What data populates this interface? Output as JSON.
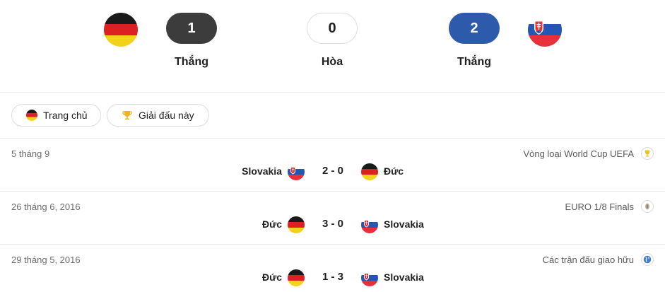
{
  "colors": {
    "dark_pill": "#3c3c3c",
    "blue_pill": "#2e5aac",
    "divider": "#ececec",
    "muted_text": "#6b6b6b"
  },
  "summary": {
    "left_team_flag": "germany-flag",
    "right_team_flag": "slovakia-flag",
    "wins_left": "1",
    "draws": "0",
    "wins_right": "2",
    "wins_left_label": "Thắng",
    "draws_label": "Hòa",
    "wins_right_label": "Thắng"
  },
  "filters": [
    {
      "label": "Trang chủ",
      "icon": "germany-flag"
    },
    {
      "label": "Giải đấu này",
      "icon": "trophy-icon"
    }
  ],
  "matches": [
    {
      "date": "5 tháng 9",
      "competition": "Vòng loại World Cup UEFA",
      "competition_icon": "trophy-icon",
      "home": "Slovakia",
      "home_flag": "slovakia-flag",
      "score": "2 - 0",
      "away": "Đức",
      "away_flag": "germany-flag"
    },
    {
      "date": "26 tháng 6, 2016",
      "competition": "EURO 1/8 Finals",
      "competition_icon": "euro-icon",
      "home": "Đức",
      "home_flag": "germany-flag",
      "score": "3 - 0",
      "away": "Slovakia",
      "away_flag": "slovakia-flag"
    },
    {
      "date": "29 tháng 5, 2016",
      "competition": "Các trận đấu giao hữu",
      "competition_icon": "globe-icon",
      "home": "Đức",
      "home_flag": "germany-flag",
      "score": "1 - 3",
      "away": "Slovakia",
      "away_flag": "slovakia-flag"
    }
  ]
}
